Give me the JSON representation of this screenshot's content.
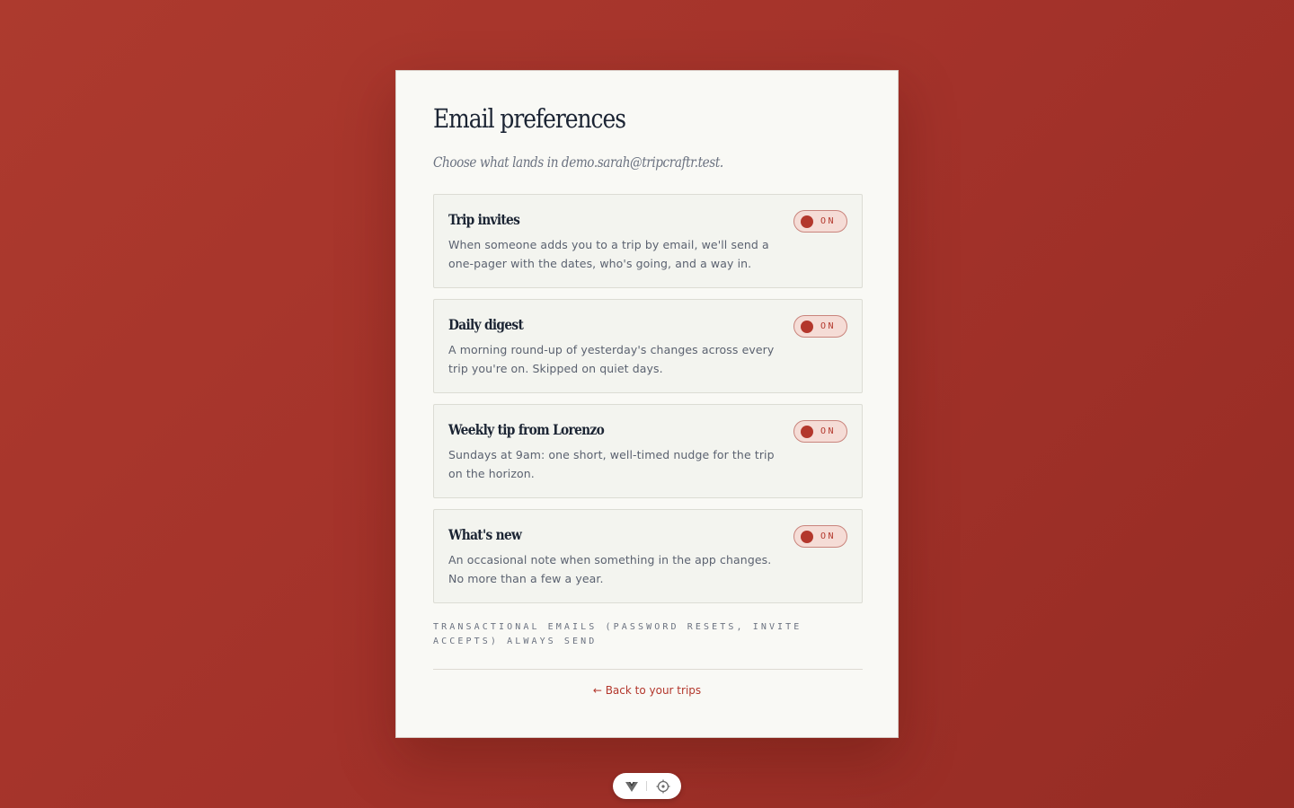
{
  "page": {
    "title": "Email preferences",
    "subtitle": "Choose what lands in demo.sarah@tripcraftr.test."
  },
  "preferences": [
    {
      "title": "Trip invites",
      "description": "When someone adds you to a trip by email, we'll send a one-pager with the dates, who's going, and a way in.",
      "toggle_label": "ON",
      "enabled": true
    },
    {
      "title": "Daily digest",
      "description": "A morning round-up of yesterday's changes across every trip you're on. Skipped on quiet days.",
      "toggle_label": "ON",
      "enabled": true
    },
    {
      "title": "Weekly tip from Lorenzo",
      "description": "Sundays at 9am: one short, well-timed nudge for the trip on the horizon.",
      "toggle_label": "ON",
      "enabled": true
    },
    {
      "title": "What's new",
      "description": "An occasional note when something in the app changes. No more than a few a year.",
      "toggle_label": "ON",
      "enabled": true
    }
  ],
  "footer": {
    "note": "Transactional emails (password resets, invite accepts) always send",
    "back_link": "← Back to your trips"
  },
  "toolbar": {
    "icons": [
      "vue-logo-icon",
      "crosshair-icon"
    ]
  },
  "colors": {
    "background": "#a8352c",
    "accent": "#b3372c",
    "card": "#f9f9f5"
  }
}
